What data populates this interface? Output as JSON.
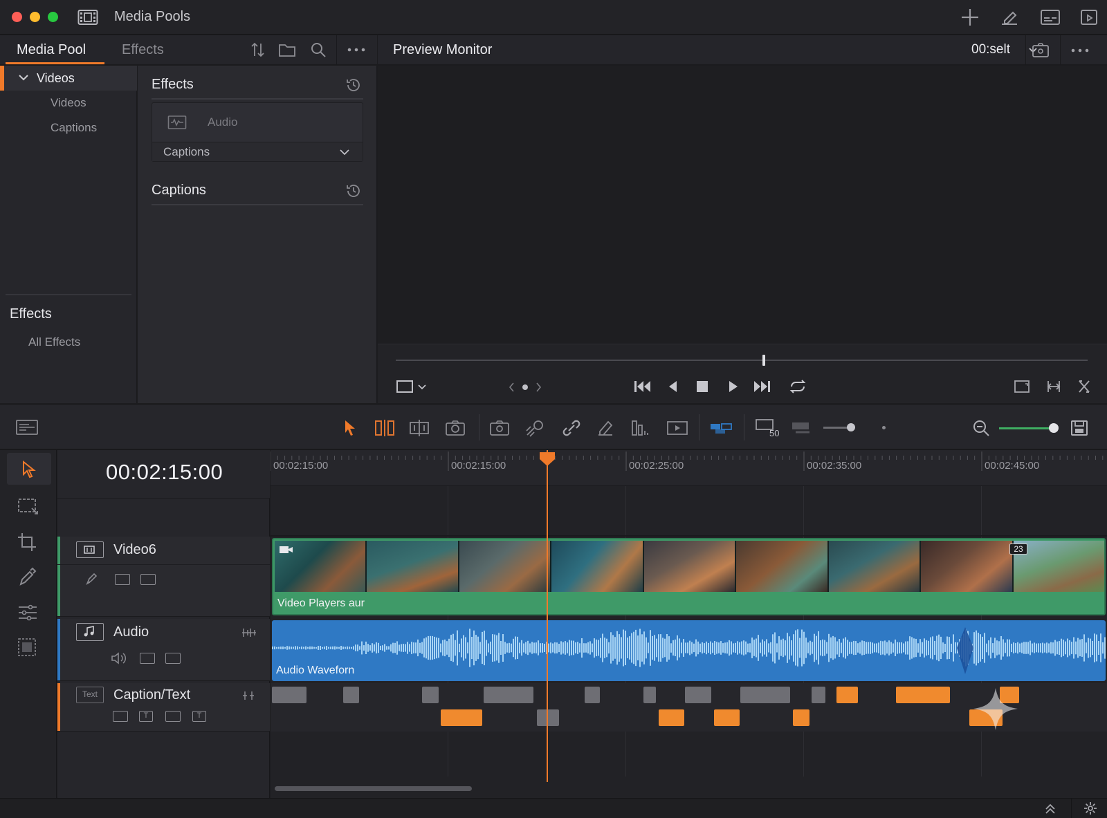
{
  "window": {
    "title": "Media Pools"
  },
  "media_pool": {
    "tabs": [
      {
        "label": "Media Pool",
        "active": true
      },
      {
        "label": "Effects",
        "active": false
      }
    ],
    "tree": {
      "root": "Videos",
      "children": [
        "Videos",
        "Captions"
      ]
    },
    "effects_section": {
      "title": "Effects",
      "item": "All Effects"
    }
  },
  "effects_panel": {
    "header": "Effects",
    "audio_item": "Audio",
    "dropdown_value": "Captions",
    "captions_header": "Captions"
  },
  "preview": {
    "title": "Preview Monitor",
    "timecode_select": "00:selt"
  },
  "timeline": {
    "timecode": "00:02:15:00",
    "ruler_labels": [
      "00:02:15:00",
      "00:02:15:00",
      "00:02:25:00",
      "00:02:35:00",
      "00:02:45:00"
    ],
    "tracks": {
      "video": {
        "name": "Video6",
        "clip_label": "Video Players aur",
        "clip_count_badge": "23"
      },
      "audio": {
        "name": "Audio",
        "clip_label": "Audio Waveforn"
      },
      "caption": {
        "name": "Caption/Text",
        "type_badge": "Text"
      }
    }
  },
  "colors": {
    "accent": "#f07a2a",
    "video_track": "#3f9a68",
    "audio_track": "#2f79c4",
    "caption_orange": "#f08a2e",
    "caption_grey": "#6e6e74",
    "playhead": "#f07a2a"
  }
}
